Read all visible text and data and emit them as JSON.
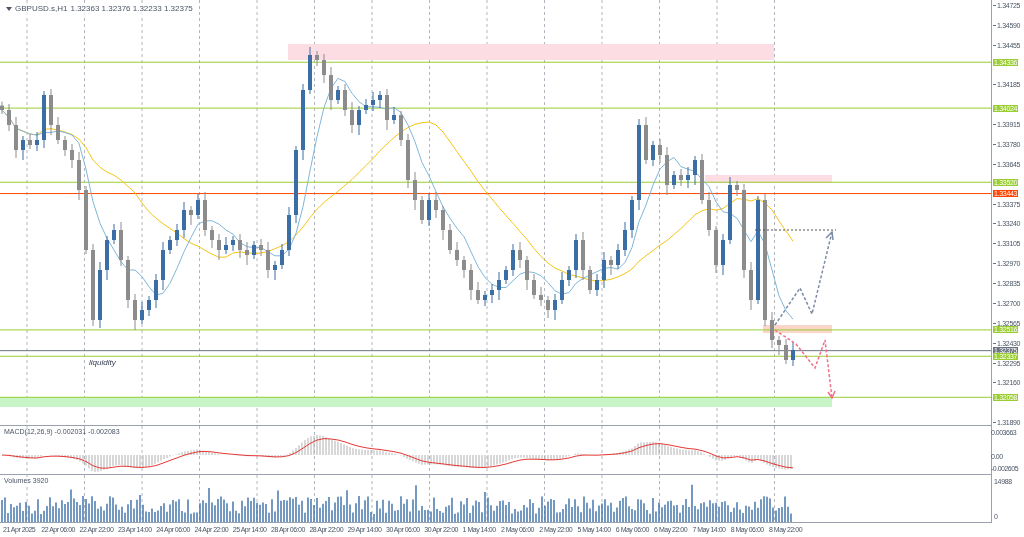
{
  "chart": {
    "title": "GBPUSD.s,H1",
    "quote": "1.32363 1.32376 1.32233 1.32375",
    "annotation": "liquidity"
  },
  "price_axis": [
    "1.34725",
    "1.34590",
    "1.34455",
    "1.34185",
    "1.33915",
    "1.33780",
    "1.33645",
    "1.33375",
    "1.33240",
    "1.33105",
    "1.32970",
    "1.32835",
    "1.32700",
    "1.32565",
    "1.32430",
    "1.32295",
    "1.32160",
    "1.31890"
  ],
  "price_labels": [
    {
      "text": "1.34336",
      "color": "#9acd32"
    },
    {
      "text": "1.34024",
      "color": "#9acd32"
    },
    {
      "text": "1.33520",
      "color": "#9acd32"
    },
    {
      "text": "1.33443",
      "color": "#ff4500"
    },
    {
      "text": "1.32516",
      "color": "#9acd32"
    },
    {
      "text": "1.32375",
      "color": "#6b7280"
    },
    {
      "text": "1.32337",
      "color": "#9acd32"
    },
    {
      "text": "1.32058",
      "color": "#9acd32"
    }
  ],
  "macd": {
    "label": "MACD(12,26,9) -0.002031 -0.002083",
    "ticks": [
      "0.003663",
      "0.00",
      "-0.002605"
    ]
  },
  "volume": {
    "label": "Volumes 3920",
    "ticks": [
      "14988",
      "0"
    ]
  },
  "time_labels": [
    "21 Apr 2025",
    "22 Apr 06:00",
    "22 Apr 22:00",
    "23 Apr 14:00",
    "24 Apr 06:00",
    "24 Apr 22:00",
    "25 Apr 14:00",
    "28 Apr 06:00",
    "28 Apr 22:00",
    "29 Apr 14:00",
    "30 Apr 06:00",
    "30 Apr 22:00",
    "1 May 14:00",
    "2 May 06:00",
    "2 May 22:00",
    "5 May 14:00",
    "6 May 06:00",
    "6 May 22:00",
    "7 May 14:00",
    "8 May 06:00",
    "8 May 22:00"
  ]
}
